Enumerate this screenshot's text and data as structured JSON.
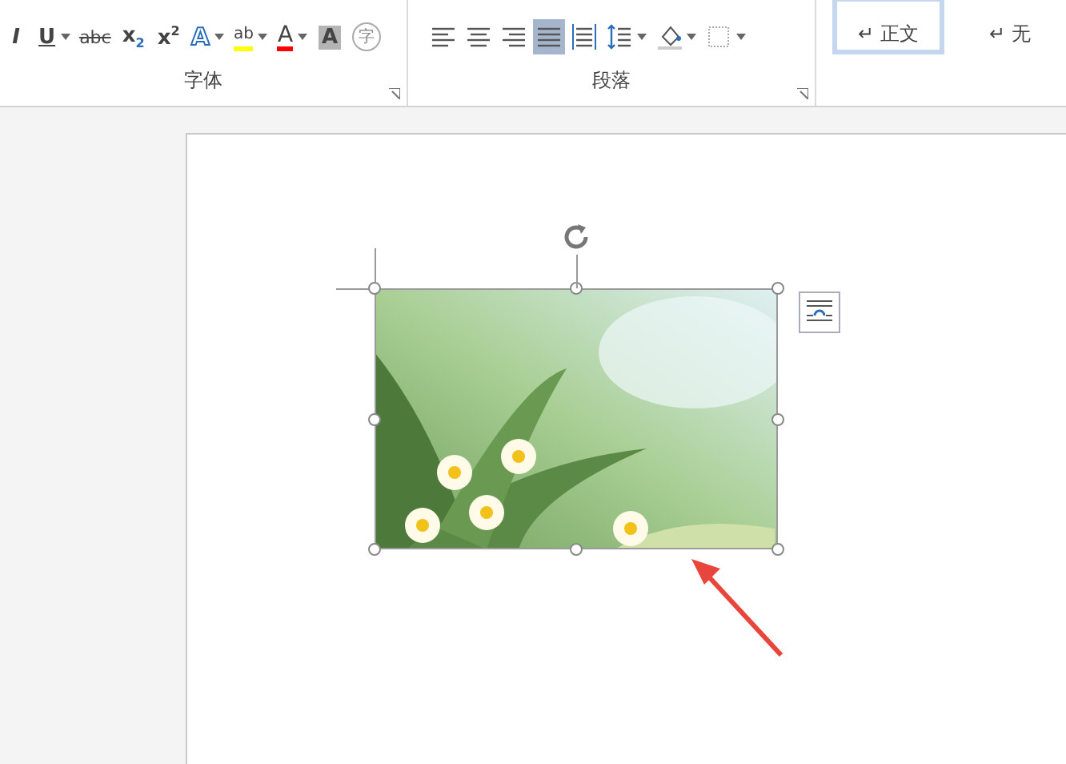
{
  "ribbon": {
    "groups": [
      {
        "label": "字体",
        "buttons": [
          {
            "kind": "italic",
            "glyph": "I",
            "dropdown": false
          },
          {
            "kind": "underline",
            "glyph": "U",
            "dropdown": true
          },
          {
            "kind": "strike",
            "glyph": "abc",
            "dropdown": false
          },
          {
            "kind": "sub",
            "glyph": "x",
            "index": "2",
            "dropdown": false
          },
          {
            "kind": "sup",
            "glyph": "x",
            "index": "2",
            "dropdown": false
          },
          {
            "kind": "effect",
            "glyph": "A",
            "dropdown": true
          },
          {
            "kind": "highlight",
            "glyph": "ab",
            "dropdown": true,
            "color": "#ffff00"
          },
          {
            "kind": "fontcolor",
            "glyph": "A",
            "dropdown": true,
            "color": "#ff0000"
          },
          {
            "kind": "shade",
            "glyph": "A",
            "dropdown": false
          },
          {
            "kind": "enclose",
            "glyph": "字",
            "dropdown": false
          }
        ]
      },
      {
        "label": "段落",
        "buttons": [
          {
            "kind": "align-left",
            "selected": false,
            "dropdown": false
          },
          {
            "kind": "align-center",
            "selected": false,
            "dropdown": false
          },
          {
            "kind": "align-right",
            "selected": false,
            "dropdown": false
          },
          {
            "kind": "justify",
            "selected": true,
            "dropdown": false
          },
          {
            "kind": "distribute",
            "selected": false,
            "dropdown": false
          },
          {
            "kind": "spacing",
            "selected": false,
            "dropdown": true
          },
          {
            "kind": "fill",
            "selected": false,
            "dropdown": true
          },
          {
            "kind": "border",
            "selected": false,
            "dropdown": true
          }
        ]
      }
    ],
    "styles": [
      {
        "mark": "↵",
        "label": "正文",
        "selected": true
      },
      {
        "mark": "↵",
        "label": "无",
        "selected": false
      }
    ]
  },
  "document": {
    "image": {
      "kind": "picture",
      "selected": true
    },
    "annotation": {
      "color": "#e8453c"
    }
  }
}
